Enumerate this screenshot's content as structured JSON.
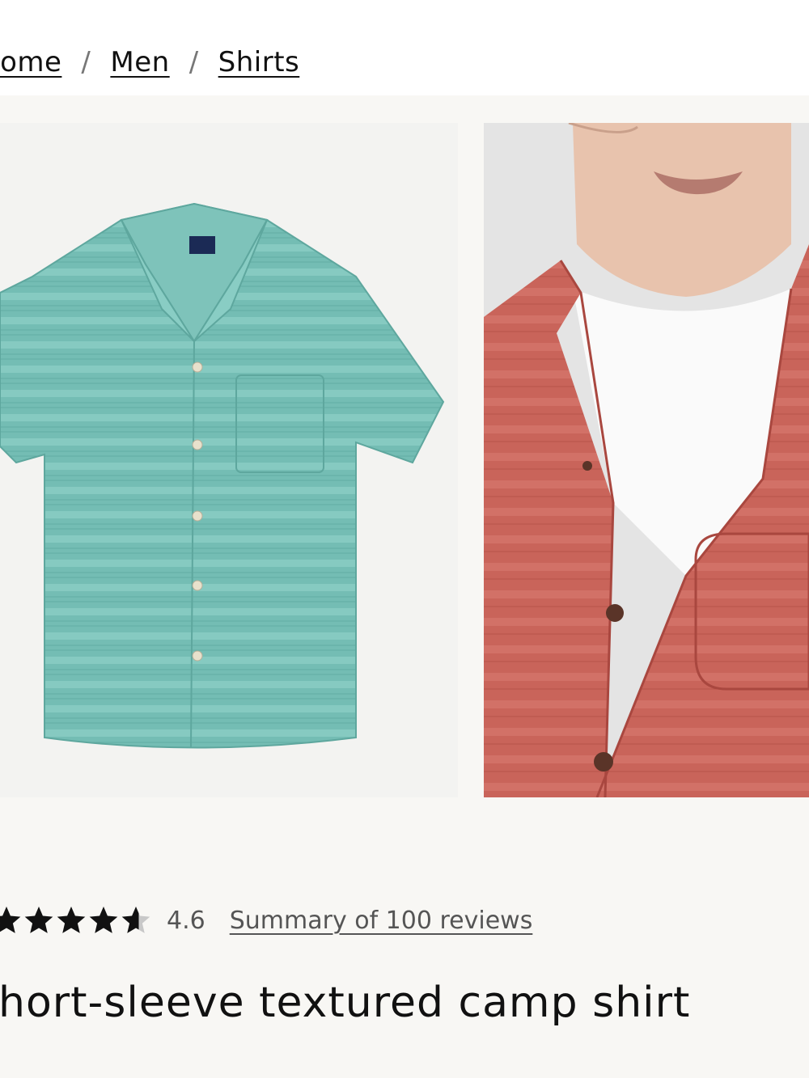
{
  "breadcrumb": {
    "items": [
      {
        "label": "Home"
      },
      {
        "label": "Men"
      },
      {
        "label": "Shirts"
      }
    ],
    "separator": "/"
  },
  "gallery": {
    "images": [
      {
        "icon": "teal-camp-shirt-flat-lay-image",
        "color": "#73bcb3"
      },
      {
        "icon": "red-camp-shirt-model-image",
        "color": "#c9645a"
      }
    ]
  },
  "product": {
    "rating": {
      "value": "4.6",
      "stars": 4.6,
      "max": 5
    },
    "reviews_link": "Summary of 100 reviews",
    "title": "Short-sleeve textured camp shirt"
  }
}
